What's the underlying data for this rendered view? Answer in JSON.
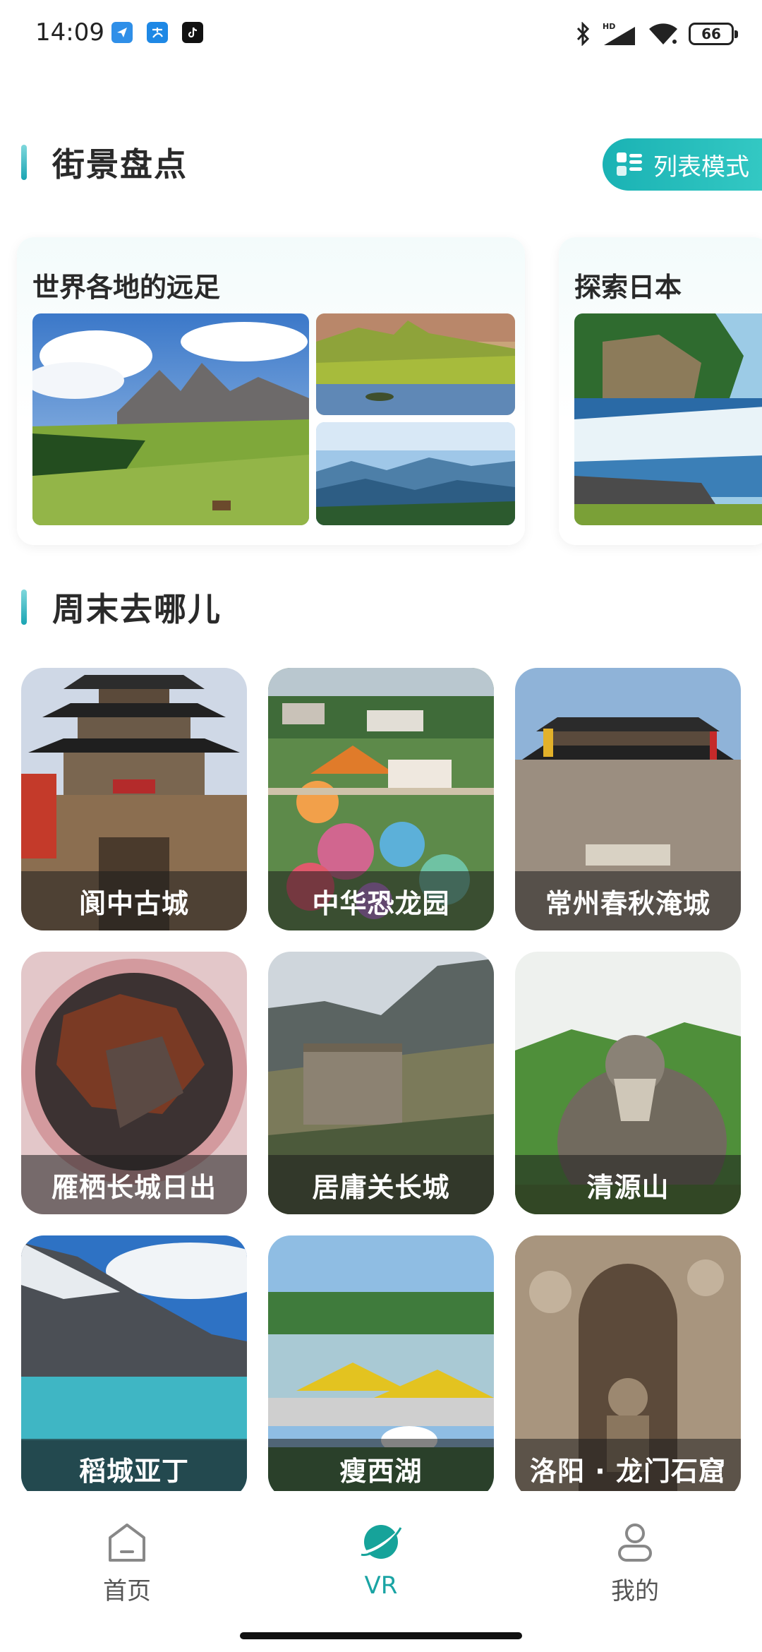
{
  "status_bar": {
    "time": "14:09",
    "battery": "66",
    "network": "HD"
  },
  "street_view": {
    "title": "街景盘点",
    "list_mode_label": "列表模式",
    "collections": [
      {
        "title": "世界各地的远足"
      },
      {
        "title": "探索日本"
      }
    ]
  },
  "weekend": {
    "title": "周末去哪儿",
    "places": [
      {
        "name": "阆中古城"
      },
      {
        "name": "中华恐龙园"
      },
      {
        "name": "常州春秋淹城"
      },
      {
        "name": "雁栖长城日出"
      },
      {
        "name": "居庸关长城"
      },
      {
        "name": "清源山"
      },
      {
        "name": "稻城亚丁"
      },
      {
        "name": "瘦西湖"
      },
      {
        "name": "洛阳 · 龙门石窟"
      }
    ]
  },
  "nav": {
    "items": [
      {
        "label": "首页",
        "icon": "home-icon"
      },
      {
        "label": "VR",
        "icon": "planet-icon"
      },
      {
        "label": "我的",
        "icon": "profile-icon"
      }
    ],
    "active_color": "#1aa4a4"
  }
}
